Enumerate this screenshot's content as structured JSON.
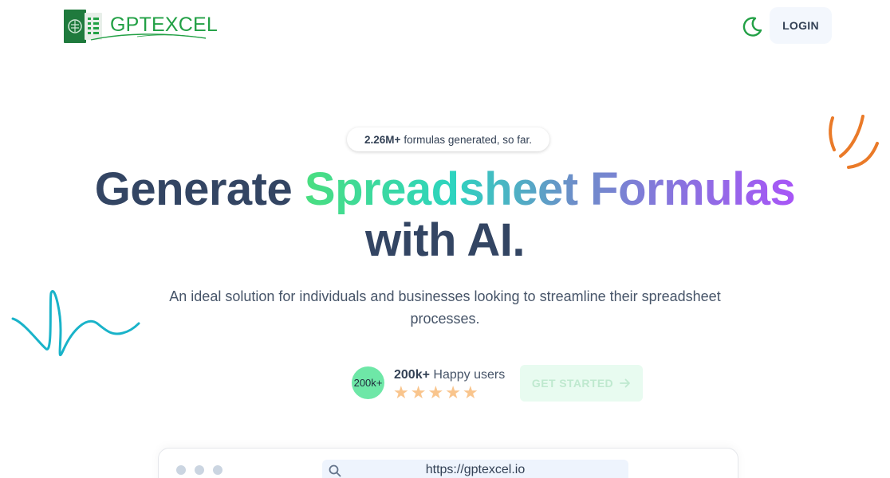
{
  "header": {
    "logo_text": "GPTEXCEL",
    "login_label": "LOGIN",
    "theme_icon": "moon-icon"
  },
  "hero": {
    "counter_value": "2.26M+",
    "counter_text": "formulas generated, so far.",
    "title_line1_plain": "Generate",
    "title_line1_gradient": "Spreadsheet Formulas",
    "title_line2": "with AI.",
    "subtitle": "An ideal solution for individuals and businesses looking to streamline their spreadsheet processes."
  },
  "social_proof": {
    "avatar_text": "200k+",
    "count": "200k+",
    "count_label": "Happy users",
    "rating": 5,
    "star_icon": "star-icon"
  },
  "cta": {
    "label": "GET STARTED",
    "icon": "arrow-right-icon"
  },
  "browser": {
    "url": "https://gptexcel.io",
    "search_icon": "search-icon"
  },
  "colors": {
    "brand_green": "#22a045",
    "title_dark": "#334563",
    "gradient_start": "#4ade80",
    "gradient_end": "#a855f7",
    "cta_bg": "#e8fbf0",
    "star": "#f9c58d",
    "accent_orange": "#ea7a28",
    "accent_cyan": "#19b3c9"
  }
}
